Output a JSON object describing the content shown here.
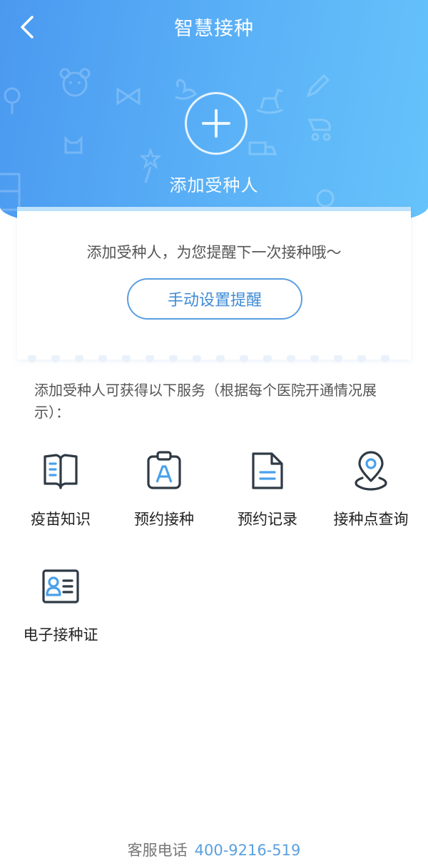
{
  "header": {
    "title": "智慧接种",
    "add_label": "添加受种人"
  },
  "card": {
    "message": "添加受种人，为您提醒下一次接种哦～",
    "button_label": "手动设置提醒"
  },
  "services": {
    "description": "添加受种人可获得以下服务（根据每个医院开通情况展示）：",
    "items": [
      {
        "label": "疫苗知识",
        "icon": "book-icon"
      },
      {
        "label": "预约接种",
        "icon": "clipboard-icon"
      },
      {
        "label": "预约记录",
        "icon": "document-icon"
      },
      {
        "label": "接种点查询",
        "icon": "location-pin-icon"
      },
      {
        "label": "电子接种证",
        "icon": "id-card-icon"
      }
    ]
  },
  "footer": {
    "label": "客服电话",
    "phone": "400-9216-519"
  },
  "colors": {
    "header_gradient_start": "#4a99f0",
    "header_gradient_end": "#66c3fa",
    "accent_blue": "#5b9fe0",
    "icon_dark": "#2f3a45",
    "icon_blue": "#4aa0ea"
  }
}
